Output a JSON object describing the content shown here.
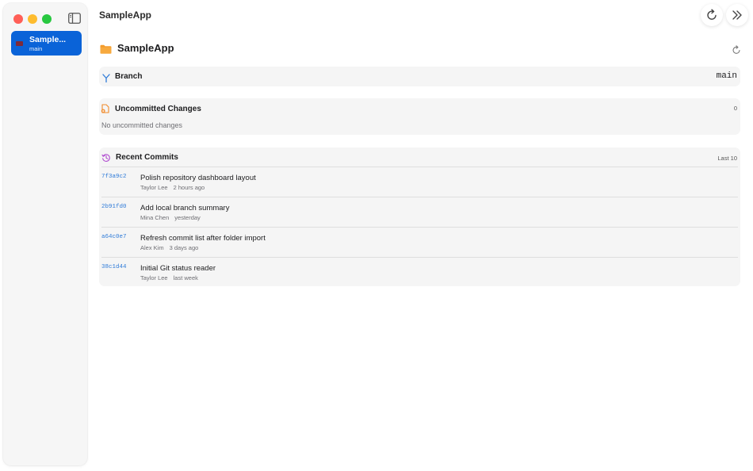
{
  "toolbar": {
    "title": "SampleApp"
  },
  "sidebar": {
    "repo": {
      "name": "Sample...",
      "branch": "main"
    }
  },
  "header": {
    "title": "SampleApp"
  },
  "branch": {
    "label": "Branch",
    "value": "main"
  },
  "changes": {
    "label": "Uncommitted Changes",
    "count": "0",
    "empty": "No uncommitted changes"
  },
  "commits": {
    "label": "Recent Commits",
    "badge": "Last 10",
    "items": [
      {
        "hash": "7f3a9c2",
        "message": "Polish repository dashboard layout",
        "author": "Taylor Lee",
        "time": "2 hours ago"
      },
      {
        "hash": "2b91fd0",
        "message": "Add local branch summary",
        "author": "Mina Chen",
        "time": "yesterday"
      },
      {
        "hash": "a64c0e7",
        "message": "Refresh commit list after folder import",
        "author": "Alex Kim",
        "time": "3 days ago"
      },
      {
        "hash": "38c1d44",
        "message": "Initial Git status reader",
        "author": "Taylor Lee",
        "time": "last week"
      }
    ]
  },
  "colors": {
    "accent": "#0a63d8",
    "hash": "#2f7bd8",
    "folder": "#f49b2b"
  },
  "icons": {
    "branch": "branch-icon",
    "changes": "changes-icon",
    "commits": "history-icon"
  }
}
